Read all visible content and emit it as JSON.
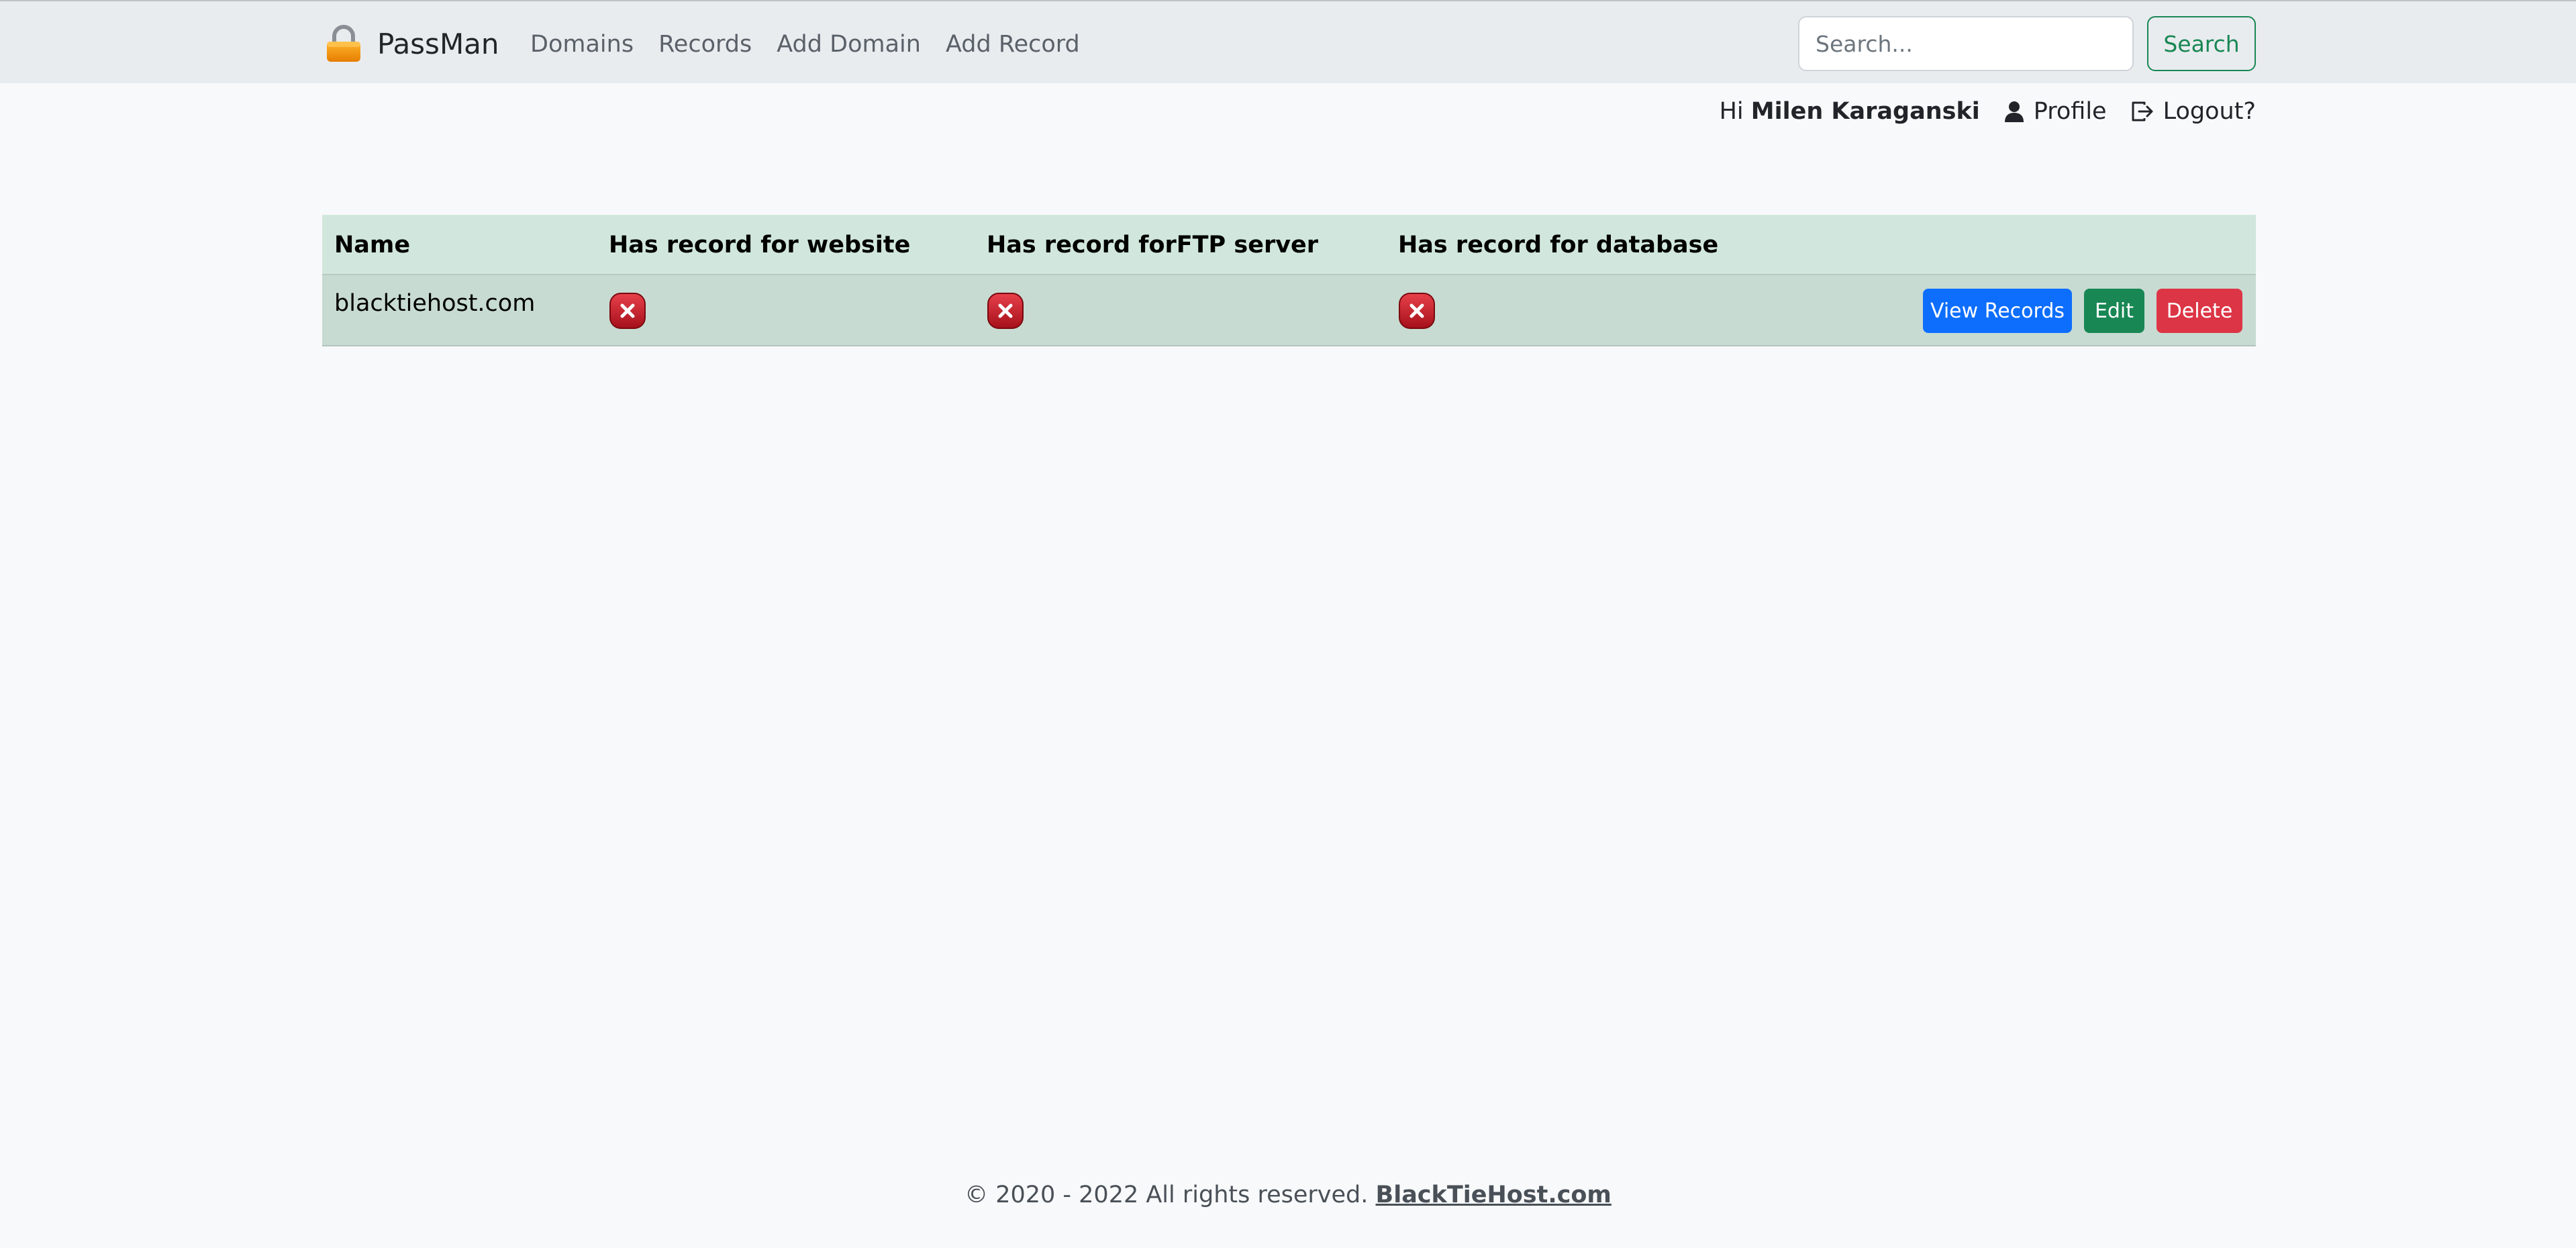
{
  "navbar": {
    "brand": "PassMan",
    "brand_icon": "lock-icon",
    "links": [
      "Domains",
      "Records",
      "Add Domain",
      "Add Record"
    ],
    "search_placeholder": "Search...",
    "search_label": "Search"
  },
  "user": {
    "greeting": "Hi",
    "name": "Milen Karaganski",
    "profile_label": "Profile",
    "profile_icon": "user-icon",
    "logout_label": "Logout?",
    "logout_icon": "logout-icon"
  },
  "table": {
    "headers": [
      "Name",
      "Has record for website",
      "Has record forFTP server",
      "Has record for database"
    ],
    "rows": [
      {
        "name": "blacktiehost.com",
        "website": false,
        "ftp": false,
        "database": false,
        "actions": [
          "View Records",
          "Edit",
          "Delete"
        ]
      }
    ]
  },
  "footer": {
    "text": "© 2020 - 2022 All rights reserved.",
    "link": "BlackTieHost.com"
  },
  "colors": {
    "primary": "#0d6efd",
    "success": "#198754",
    "danger": "#dc3545",
    "table_header": "#d1e7dd"
  }
}
